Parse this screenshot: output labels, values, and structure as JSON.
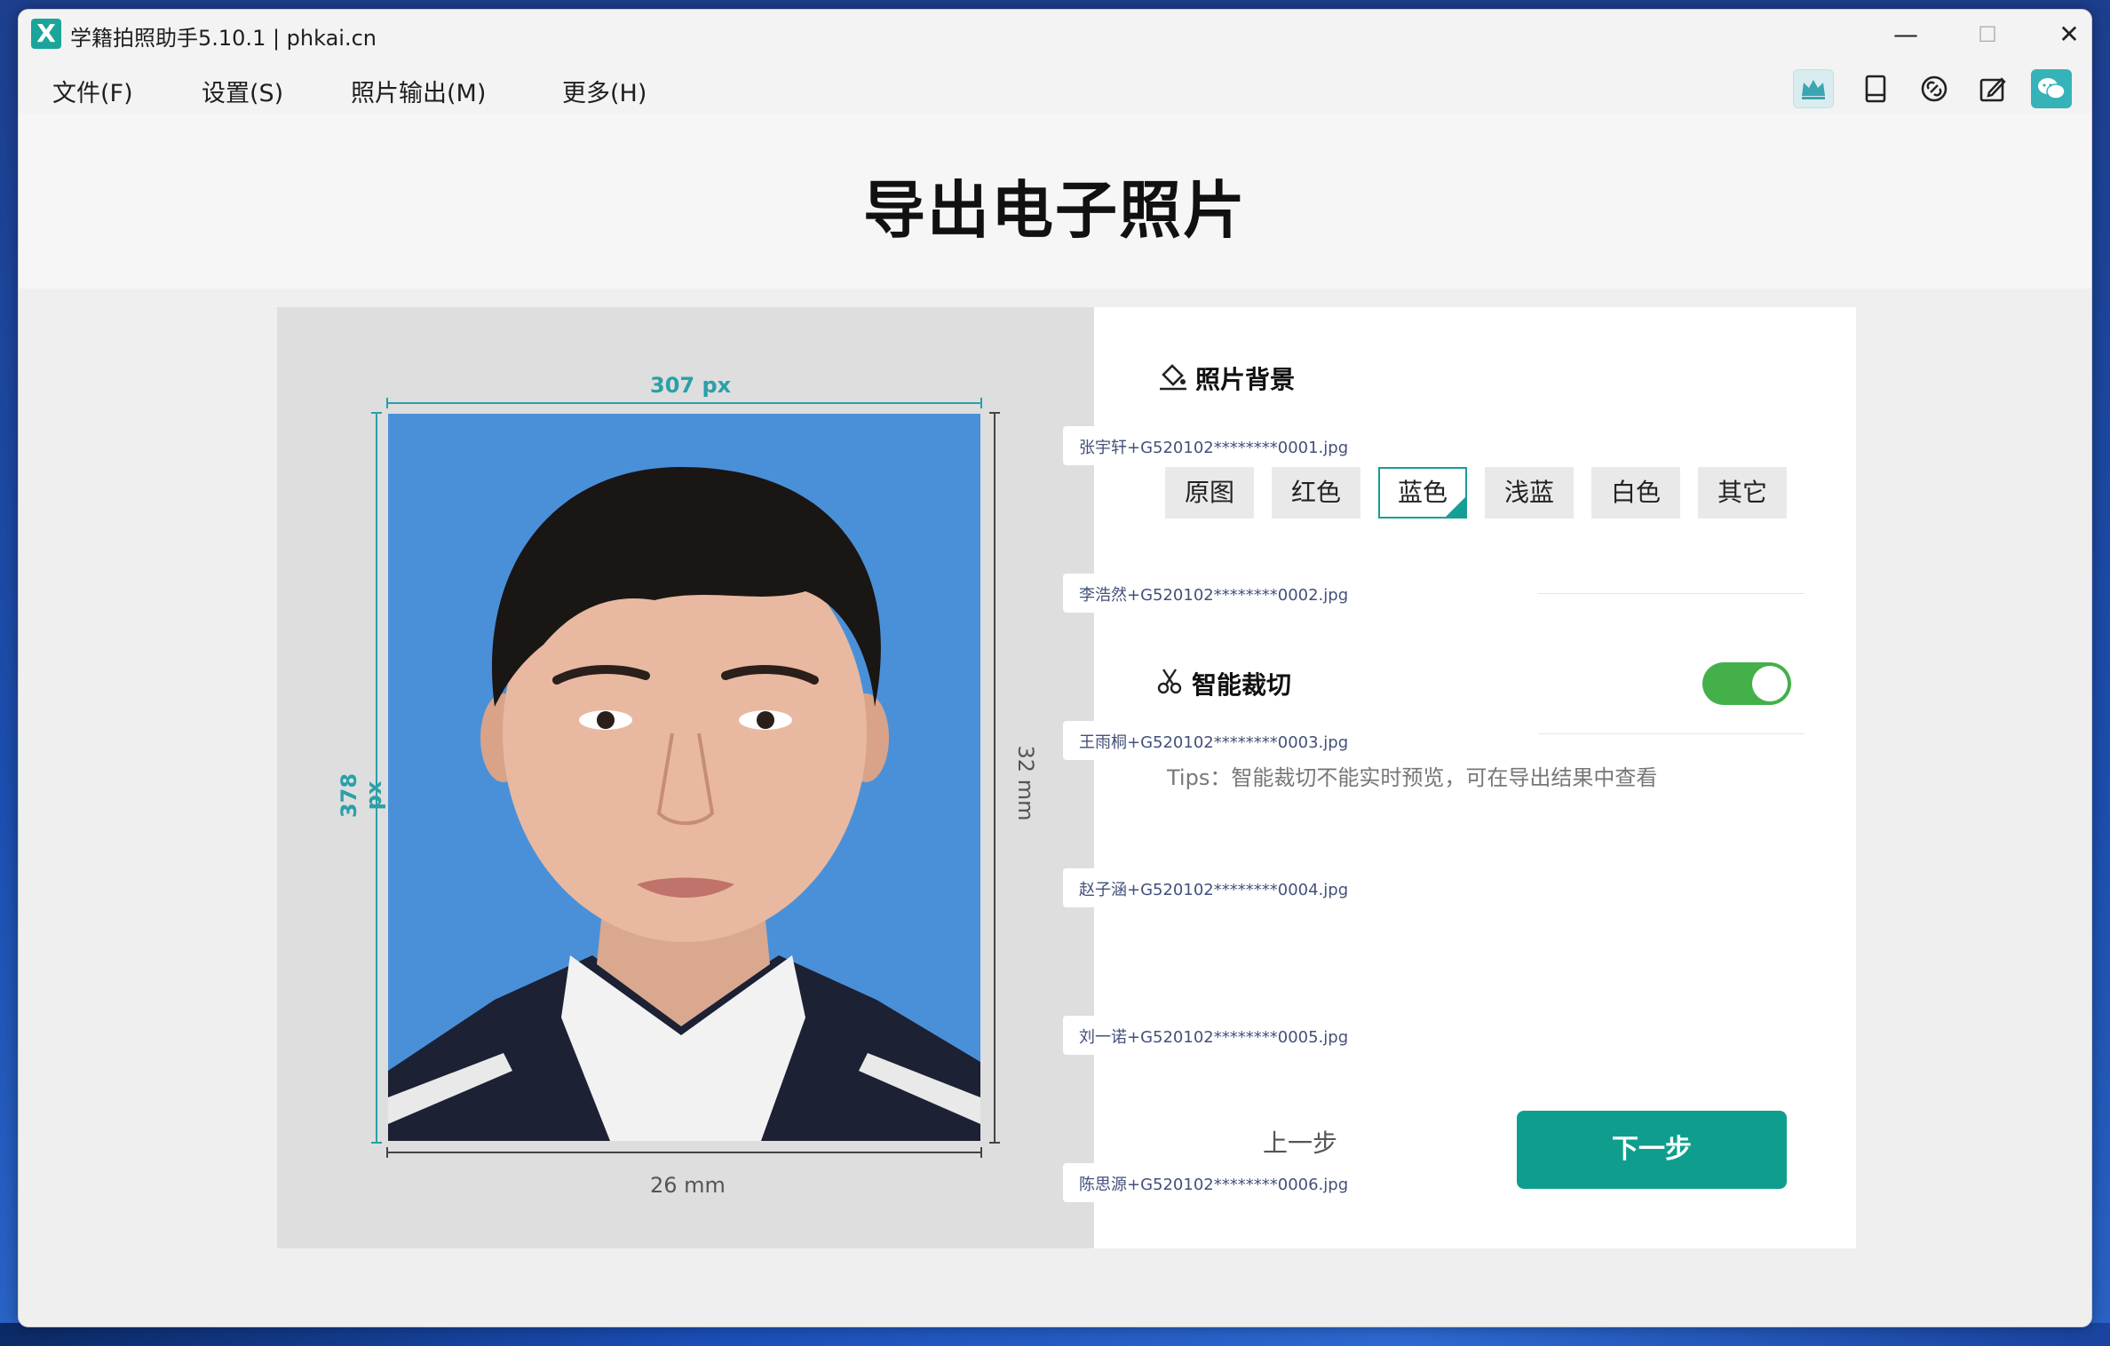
{
  "window": {
    "title": "学籍拍照助手5.10.1 | phkai.cn",
    "logo": "X",
    "controls": {
      "minimize": "—",
      "maximize": "☐",
      "close": "✕"
    }
  },
  "menu": {
    "items": [
      "文件(F)",
      "设置(S)",
      "照片输出(M)",
      "更多(H)"
    ]
  },
  "toolbar_icons": [
    "crown-icon",
    "tablet-icon",
    "link-icon",
    "edit-icon",
    "wechat-icon"
  ],
  "page": {
    "title": "导出电子照片"
  },
  "preview": {
    "width_px_label": "307 px",
    "height_px_label": "378 px",
    "height_mm_label": "32 mm",
    "width_mm_label": "26 mm",
    "photo_background": "#4a90d9"
  },
  "settings": {
    "background_title": "照片背景",
    "background_options": [
      "原图",
      "红色",
      "蓝色",
      "浅蓝",
      "白色",
      "其它"
    ],
    "selected_background": "蓝色",
    "crop_title": "智能裁切",
    "crop_enabled": true,
    "tips": "Tips：智能裁切不能实时预览，可在导出结果中查看",
    "prev_label": "上一步",
    "next_label": "下一步"
  },
  "files": [
    "张宇轩+G520102********0001.jpg",
    "李浩然+G520102********0002.jpg",
    "王雨桐+G520102********0003.jpg",
    "赵子涵+G520102********0004.jpg",
    "刘一诺+G520102********0005.jpg",
    "陈思源+G520102********0006.jpg"
  ],
  "colors": {
    "accent": "#169e94",
    "next_button": "#0f9e8e",
    "toggle_on": "#43b04a",
    "dimension_teal": "#2aa0a8"
  }
}
